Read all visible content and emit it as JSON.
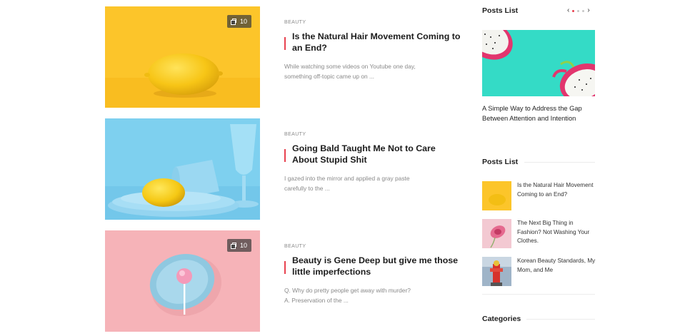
{
  "posts": [
    {
      "category": "Beauty",
      "title": "Is the Natural Hair Movement Coming to an End?",
      "excerpt": "While watching some videos on Youtube one day, something off-topic came up on ...",
      "gallery_count": "10",
      "image": "lemon-on-yellow"
    },
    {
      "category": "Beauty",
      "title": "Going Bald Taught Me Not to Care About Stupid Shit",
      "excerpt": "I gazed into the mirror and applied a gray paste carefully to the ...",
      "image": "lemon-on-blue-plates"
    },
    {
      "category": "Beauty",
      "title": "Beauty is Gene Deep but give me those little imperfections",
      "excerpt": "Q. Why do pretty people get away with murder? A. Preservation of the ...",
      "gallery_count": "10",
      "image": "lollipop-on-pink"
    }
  ],
  "sidebar": {
    "slider_widget": {
      "title": "Posts List",
      "featured_title": "A Simple Way to Address the Gap Between Attention and Intention",
      "image": "dragon-fruit-on-teal",
      "nav_prev_icon": "chevron-left-icon",
      "nav_next_icon": "chevron-right-icon",
      "dots": 3,
      "active_dot": 0
    },
    "list_widget": {
      "title": "Posts List",
      "items": [
        {
          "title": "Is the Natural Hair Movement Coming to an End?",
          "image": "lemon-on-yellow"
        },
        {
          "title": "The Next Big Thing in Fashion? Not Washing Your Clothes.",
          "image": "pink-flower"
        },
        {
          "title": "Korean Beauty Standards, My Mom, and Me",
          "image": "red-hydrant"
        }
      ]
    },
    "categories_widget": {
      "title": "Categories"
    }
  },
  "colors": {
    "accent": "#e8414f",
    "yellow": "#fcc52a",
    "sky_blue": "#7ed0ef",
    "pink": "#f6b3b8",
    "teal": "#34dbc6"
  }
}
